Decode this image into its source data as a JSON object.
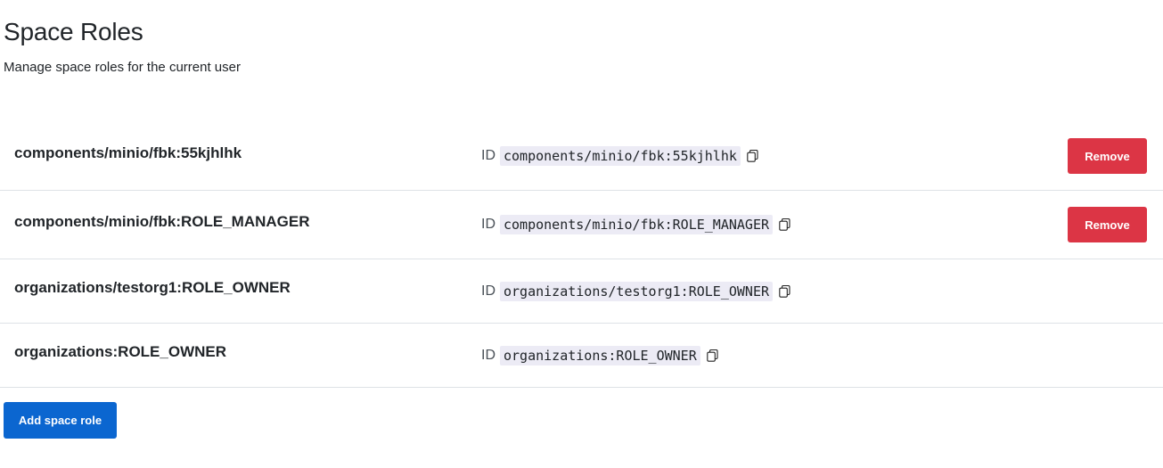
{
  "header": {
    "title": "Space Roles",
    "subtitle": "Manage space roles for the current user"
  },
  "roles": [
    {
      "name": "components/minio/fbk:55kjhlhk",
      "id_label": "ID",
      "id": "components/minio/fbk:55kjhlhk",
      "remove_label": "Remove"
    },
    {
      "name": "components/minio/fbk:ROLE_MANAGER",
      "id_label": "ID",
      "id": "components/minio/fbk:ROLE_MANAGER",
      "remove_label": "Remove"
    },
    {
      "name": "organizations/testorg1:ROLE_OWNER",
      "id_label": "ID",
      "id": "organizations/testorg1:ROLE_OWNER"
    },
    {
      "name": "organizations:ROLE_OWNER",
      "id_label": "ID",
      "id": "organizations:ROLE_OWNER"
    }
  ],
  "actions": {
    "add_label": "Add space role"
  },
  "icons": {
    "copy": "copy-icon"
  },
  "colors": {
    "danger": "#dc3545",
    "primary": "#0b66d0",
    "code_bg": "#ecebf5"
  }
}
